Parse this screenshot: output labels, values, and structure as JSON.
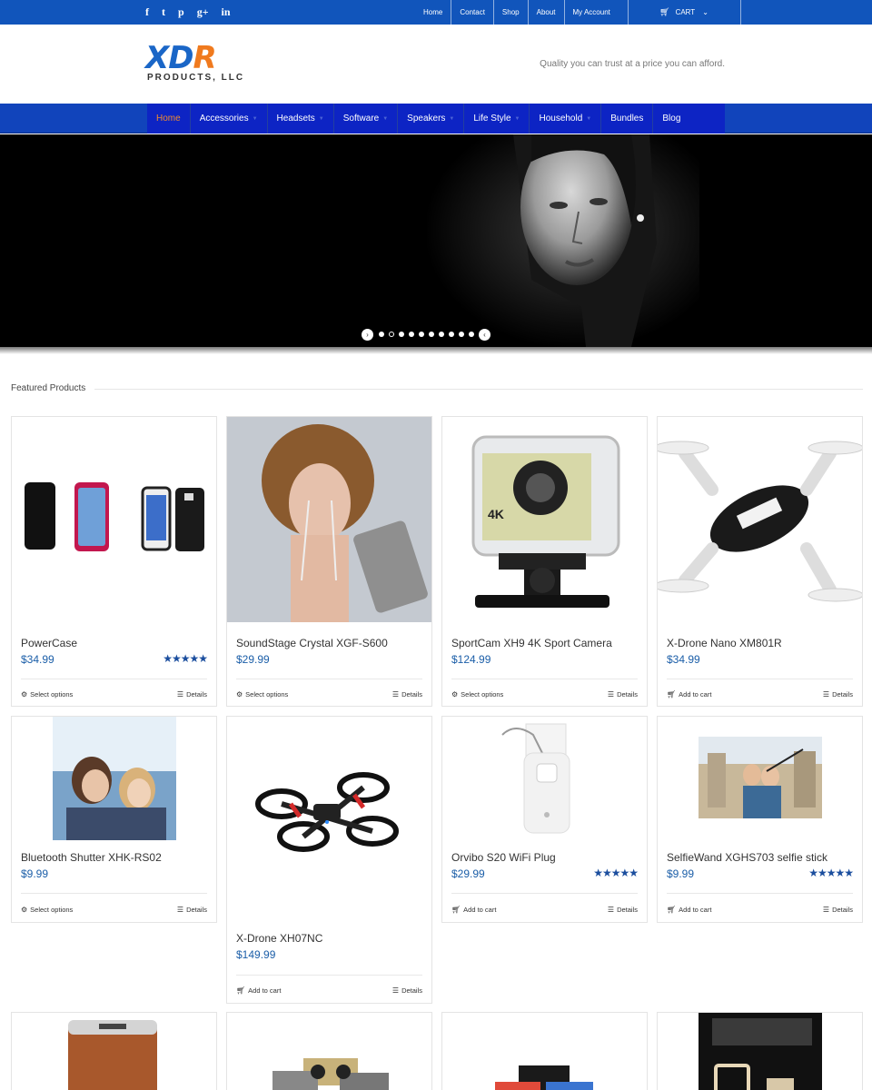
{
  "topbar": {
    "social": [
      {
        "name": "facebook-icon",
        "glyph": "f"
      },
      {
        "name": "twitter-icon",
        "glyph": "t"
      },
      {
        "name": "pinterest-icon",
        "glyph": "p"
      },
      {
        "name": "google-plus-icon",
        "glyph": "g+"
      },
      {
        "name": "linkedin-icon",
        "glyph": "in"
      }
    ],
    "links": [
      "Home",
      "Contact",
      "Shop",
      "About",
      "My Account"
    ],
    "cart_label": "CART"
  },
  "header": {
    "logo_main": "XDR",
    "logo_sub": "PRODUCTS, LLC",
    "tagline": "Quality you can trust at a price you can afford."
  },
  "nav": {
    "items": [
      "Home",
      "Accessories",
      "Headsets",
      "Software",
      "Speakers",
      "Life Style",
      "Household",
      "Bundles",
      "Blog"
    ]
  },
  "slider": {
    "dot_count": 10,
    "active_dot": 0
  },
  "featured": {
    "title": "Featured Products",
    "labels": {
      "select_options": "Select options",
      "add_to_cart": "Add to cart",
      "details": "Details"
    },
    "products": [
      {
        "title": "PowerCase",
        "price": "$34.99",
        "rating": 4.5,
        "action": "Select options"
      },
      {
        "title": "SoundStage Crystal XGF-S600",
        "price": "$29.99",
        "rating": null,
        "action": "Select options"
      },
      {
        "title": "SportCam XH9 4K Sport Camera",
        "price": "$124.99",
        "rating": null,
        "action": "Select options"
      },
      {
        "title": "X-Drone Nano XM801R",
        "price": "$34.99",
        "rating": null,
        "action": "Add to cart"
      },
      {
        "title": "Bluetooth Shutter XHK-RS02",
        "price": "$9.99",
        "rating": null,
        "action": "Select options"
      },
      {
        "title": "X-Drone XH07NC",
        "price": "$149.99",
        "rating": null,
        "action": "Add to cart"
      },
      {
        "title": "Orvibo S20 WiFi Plug",
        "price": "$29.99",
        "rating": 5,
        "action": "Add to cart"
      },
      {
        "title": "SelfieWand XGHS703 selfie stick",
        "price": "$9.99",
        "rating": 5,
        "action": "Add to cart"
      }
    ]
  },
  "colors": {
    "topbar": "#1155bb",
    "nav": "#0d24c4",
    "accent_orange": "#f28a2e",
    "price_blue": "#1b5ea8"
  }
}
